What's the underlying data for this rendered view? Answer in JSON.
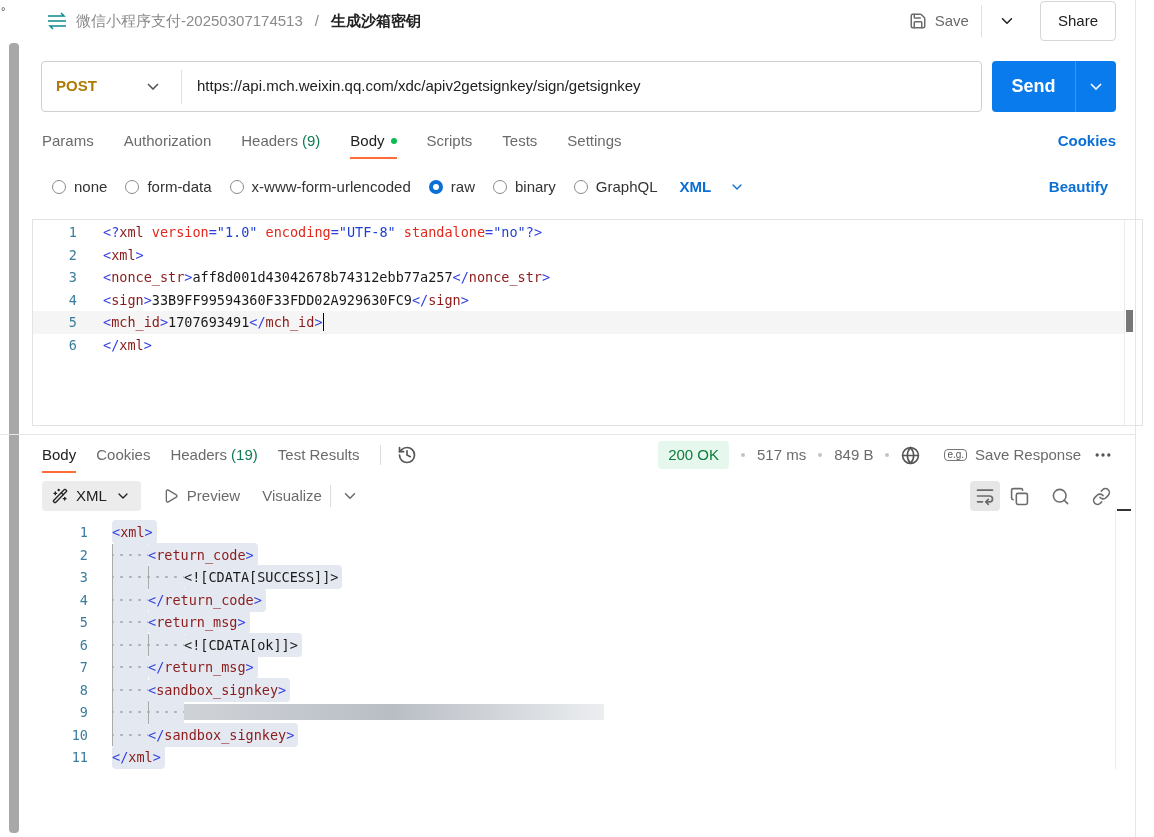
{
  "corner_mark": "°",
  "breadcrumb": {
    "collection": "微信小程序支付-20250307174513",
    "separator": "/",
    "request": "生成沙箱密钥"
  },
  "header_actions": {
    "save": "Save",
    "share": "Share"
  },
  "request": {
    "method": "POST",
    "url": "https://api.mch.weixin.qq.com/xdc/apiv2getsignkey/sign/getsignkey",
    "send": "Send"
  },
  "request_tabs": [
    {
      "label": "Params",
      "selected": false
    },
    {
      "label": "Authorization",
      "selected": false
    },
    {
      "label": "Headers",
      "count": "(9)",
      "selected": false
    },
    {
      "label": "Body",
      "dot": true,
      "selected": true
    },
    {
      "label": "Scripts",
      "selected": false
    },
    {
      "label": "Tests",
      "selected": false
    },
    {
      "label": "Settings",
      "selected": false
    }
  ],
  "cookies_link": "Cookies",
  "body_types": [
    {
      "label": "none",
      "selected": false
    },
    {
      "label": "form-data",
      "selected": false
    },
    {
      "label": "x-www-form-urlencoded",
      "selected": false
    },
    {
      "label": "raw",
      "selected": true
    },
    {
      "label": "binary",
      "selected": false
    },
    {
      "label": "GraphQL",
      "selected": false
    }
  ],
  "body_format": "XML",
  "beautify": "Beautify",
  "request_body": [
    {
      "number": "1",
      "tokens": [
        {
          "kind": "bracket",
          "text": "<?"
        },
        {
          "kind": "name",
          "text": "xml "
        },
        {
          "kind": "attr",
          "text": "version"
        },
        {
          "kind": "bracket",
          "text": "="
        },
        {
          "kind": "string",
          "text": "\"1.0\" "
        },
        {
          "kind": "attr",
          "text": "encoding"
        },
        {
          "kind": "bracket",
          "text": "="
        },
        {
          "kind": "string",
          "text": "\"UTF-8\" "
        },
        {
          "kind": "attr",
          "text": "standalone"
        },
        {
          "kind": "bracket",
          "text": "="
        },
        {
          "kind": "string",
          "text": "\"no\""
        },
        {
          "kind": "bracket",
          "text": "?>"
        }
      ]
    },
    {
      "number": "2",
      "tokens": [
        {
          "kind": "bracket",
          "text": "<"
        },
        {
          "kind": "name",
          "text": "xml"
        },
        {
          "kind": "bracket",
          "text": ">"
        }
      ]
    },
    {
      "number": "3",
      "tokens": [
        {
          "kind": "bracket",
          "text": "<"
        },
        {
          "kind": "name",
          "text": "nonce_str"
        },
        {
          "kind": "bracket",
          "text": ">"
        },
        {
          "kind": "text",
          "text": "aff8d001d43042678b74312ebb77a257"
        },
        {
          "kind": "bracket",
          "text": "</"
        },
        {
          "kind": "name",
          "text": "nonce_str"
        },
        {
          "kind": "bracket",
          "text": ">"
        }
      ]
    },
    {
      "number": "4",
      "tokens": [
        {
          "kind": "bracket",
          "text": "<"
        },
        {
          "kind": "name",
          "text": "sign"
        },
        {
          "kind": "bracket",
          "text": ">"
        },
        {
          "kind": "text",
          "text": "33B9FF99594360F33FDD02A929630FC9"
        },
        {
          "kind": "bracket",
          "text": "</"
        },
        {
          "kind": "name",
          "text": "sign"
        },
        {
          "kind": "bracket",
          "text": ">"
        }
      ]
    },
    {
      "number": "5",
      "active": true,
      "tokens": [
        {
          "kind": "bracket",
          "text": "<"
        },
        {
          "kind": "name",
          "text": "mch_id"
        },
        {
          "kind": "bracket",
          "text": ">"
        },
        {
          "kind": "text",
          "text": "1707693491"
        },
        {
          "kind": "bracket",
          "text": "</"
        },
        {
          "kind": "name",
          "text": "mch_id"
        },
        {
          "kind": "bracket",
          "text": ">"
        }
      ]
    },
    {
      "number": "6",
      "tokens": [
        {
          "kind": "bracket",
          "text": "</"
        },
        {
          "kind": "name",
          "text": "xml"
        },
        {
          "kind": "bracket",
          "text": ">"
        }
      ]
    }
  ],
  "response_tabs": [
    {
      "label": "Body",
      "selected": true
    },
    {
      "label": "Cookies",
      "selected": false
    },
    {
      "label": "Headers",
      "count": "(19)",
      "selected": false
    },
    {
      "label": "Test Results",
      "selected": false
    }
  ],
  "response_meta": {
    "status": "200 OK",
    "time": "517 ms",
    "size": "849 B",
    "save_response": "Save Response",
    "example_label": "e.g."
  },
  "response_toolbar": {
    "format": "XML",
    "preview": "Preview",
    "visualize": "Visualize"
  },
  "response_body": [
    {
      "number": "1",
      "tokens": [
        {
          "kind": "bracket",
          "text": "<"
        },
        {
          "kind": "name",
          "text": "xml"
        },
        {
          "kind": "bracket",
          "text": ">"
        }
      ],
      "children": [
        {
          "number": "2",
          "tokens": [
            {
              "kind": "bracket",
              "text": "<"
            },
            {
              "kind": "name",
              "text": "return_code"
            },
            {
              "kind": "bracket",
              "text": ">"
            }
          ],
          "children": [
            {
              "number": "3",
              "tokens": [
                {
                  "kind": "text",
                  "text": "<![CDATA[SUCCESS]]>"
                }
              ]
            }
          ]
        },
        {
          "number": "4",
          "tokens": [
            {
              "kind": "bracket",
              "text": "</"
            },
            {
              "kind": "name",
              "text": "return_code"
            },
            {
              "kind": "bracket",
              "text": ">"
            }
          ]
        },
        {
          "number": "5",
          "tokens": [
            {
              "kind": "bracket",
              "text": "<"
            },
            {
              "kind": "name",
              "text": "return_msg"
            },
            {
              "kind": "bracket",
              "text": ">"
            }
          ],
          "children": [
            {
              "number": "6",
              "tokens": [
                {
                  "kind": "text",
                  "text": "<![CDATA[ok]]>"
                }
              ]
            }
          ]
        },
        {
          "number": "7",
          "tokens": [
            {
              "kind": "bracket",
              "text": "</"
            },
            {
              "kind": "name",
              "text": "return_msg"
            },
            {
              "kind": "bracket",
              "text": ">"
            }
          ]
        },
        {
          "number": "8",
          "tokens": [
            {
              "kind": "bracket",
              "text": "<"
            },
            {
              "kind": "name",
              "text": "sandbox_signkey"
            },
            {
              "kind": "bracket",
              "text": ">"
            }
          ],
          "children": [
            {
              "number": "9",
              "redacted": true
            }
          ]
        },
        {
          "number": "10",
          "tokens": [
            {
              "kind": "bracket",
              "text": "</"
            },
            {
              "kind": "name",
              "text": "sandbox_signkey"
            },
            {
              "kind": "bracket",
              "text": ">"
            }
          ]
        }
      ]
    },
    {
      "number": "11",
      "tokens": [
        {
          "kind": "bracket",
          "text": "</"
        },
        {
          "kind": "name",
          "text": "xml"
        },
        {
          "kind": "bracket",
          "text": ">"
        }
      ]
    }
  ]
}
